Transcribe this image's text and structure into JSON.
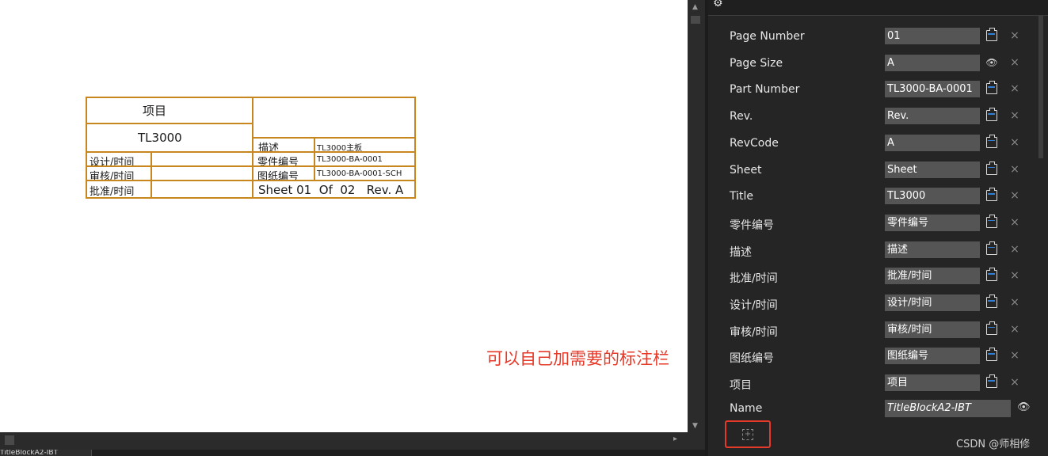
{
  "title_block": {
    "project_label": "项目",
    "project_value": "TL3000",
    "description_label": "描述",
    "description_value": "TL3000主板",
    "part_number_label": "零件编号",
    "part_number_value": "TL3000-BA-0001",
    "drawing_number_label": "图纸编号",
    "drawing_number_value": "TL3000-BA-0001-SCH",
    "design_label": "设计/时间",
    "review_label": "审核/时间",
    "approve_label": "批准/时间",
    "sheet_text": "Sheet 01  Of  02   Rev. A"
  },
  "document_tab": "TitleBlockA2-IBT",
  "properties": [
    {
      "label": "Page Number",
      "value": "01",
      "icon": "clipboard-icon"
    },
    {
      "label": "Page Size",
      "value": "A",
      "icon": "eye-icon"
    },
    {
      "label": "Part Number",
      "value": "TL3000-BA-0001",
      "icon": "clipboard-icon"
    },
    {
      "label": "Rev.",
      "value": "Rev.",
      "icon": "clipboard-icon"
    },
    {
      "label": "RevCode",
      "value": "A",
      "icon": "clipboard-icon"
    },
    {
      "label": "Sheet",
      "value": "Sheet",
      "icon": "clipboard-icon"
    },
    {
      "label": "Title",
      "value": "TL3000",
      "icon": "clipboard-icon"
    },
    {
      "label": "零件编号",
      "value": "零件编号",
      "icon": "clipboard-icon"
    },
    {
      "label": "描述",
      "value": "描述",
      "icon": "clipboard-icon"
    },
    {
      "label": "批准/时间",
      "value": "批准/时间",
      "icon": "clipboard-icon"
    },
    {
      "label": "设计/时间",
      "value": "设计/时间",
      "icon": "clipboard-icon"
    },
    {
      "label": "审核/时间",
      "value": "审核/时间",
      "icon": "clipboard-icon"
    },
    {
      "label": "图纸编号",
      "value": "图纸编号",
      "icon": "clipboard-icon"
    },
    {
      "label": "项目",
      "value": "项目",
      "icon": "clipboard-icon"
    }
  ],
  "name_row": {
    "label": "Name",
    "value": "TitleBlockA2-IBT"
  },
  "delete_glyph": "×",
  "annotation": "可以自己加需要的标注栏",
  "watermark": "CSDN @师相修",
  "colors": {
    "title_block_border": "#c8861e",
    "annotation": "#e53a2a",
    "panel_bg": "#252526",
    "field_bg": "#555555"
  }
}
